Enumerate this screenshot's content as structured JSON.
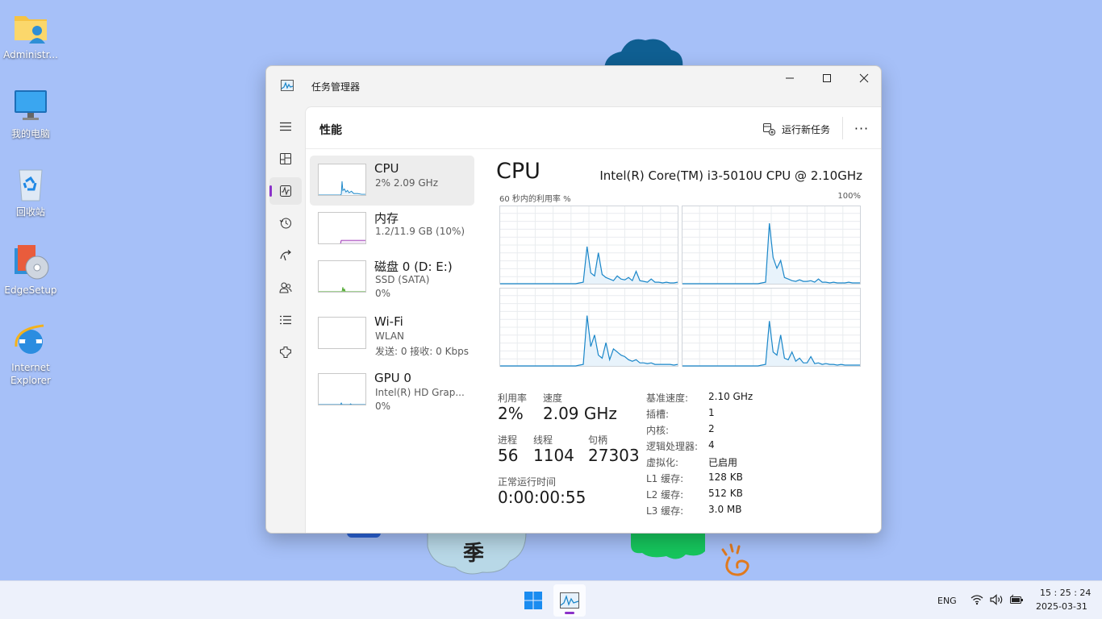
{
  "colors": {
    "accent": "#8b32c9",
    "cpu_line": "#1b87c9",
    "mem_line": "#9b30b4",
    "disk_line": "#4ea72e",
    "desktop": "#a6c0f8"
  },
  "desktop": {
    "icons": [
      {
        "label": "Administr...",
        "icon": "user-folder-icon"
      },
      {
        "label": "我的电脑",
        "icon": "monitor-icon"
      },
      {
        "label": "回收站",
        "icon": "recycle-bin-icon"
      },
      {
        "label": "EdgeSetup",
        "icon": "installer-icon"
      },
      {
        "label": "Internet\nExplorer",
        "icon": "internet-explorer-icon"
      }
    ],
    "wallpaper_glyph": "季"
  },
  "window": {
    "title": "任务管理器",
    "controls": [
      "minimize-icon",
      "maximize-icon",
      "close-icon"
    ],
    "nav": [
      "menu-icon",
      "processes-icon",
      "performance-icon",
      "app-history-icon",
      "startup-apps-icon",
      "users-icon",
      "details-icon",
      "services-icon",
      "settings-icon"
    ],
    "page_title": "性能",
    "run_new_task": "运行新任务",
    "more": "···"
  },
  "devices": [
    {
      "name": "CPU",
      "line1": "2% 2.09 GHz",
      "line2": ""
    },
    {
      "name": "内存",
      "line1": "1.2/11.9 GB (10%)",
      "line2": ""
    },
    {
      "name": "磁盘 0 (D: E:)",
      "line1": "SSD (SATA)",
      "line2": "0%"
    },
    {
      "name": "Wi-Fi",
      "line1": "WLAN",
      "line2": "发送: 0 接收: 0 Kbps"
    },
    {
      "name": "GPU 0",
      "line1": "Intel(R) HD Grap...",
      "line2": "0%"
    }
  ],
  "cpu": {
    "heading": "CPU",
    "model": "Intel(R) Core(TM) i3-5010U CPU @ 2.10GHz",
    "graph_label": "60 秒内的利用率 %",
    "graph_max": "100%",
    "stats": {
      "util_label": "利用率",
      "util": "2%",
      "speed_label": "速度",
      "speed": "2.09 GHz",
      "proc_label": "进程",
      "proc": "56",
      "threads_label": "线程",
      "threads": "1104",
      "handles_label": "句柄",
      "handles": "27303",
      "uptime_label": "正常运行时间",
      "uptime": "0:00:00:55"
    },
    "info": [
      {
        "label": "基准速度:",
        "value": "2.10 GHz"
      },
      {
        "label": "插槽:",
        "value": "1"
      },
      {
        "label": "内核:",
        "value": "2"
      },
      {
        "label": "逻辑处理器:",
        "value": "4"
      },
      {
        "label": "虚拟化:",
        "value": "已启用"
      },
      {
        "label": "L1 缓存:",
        "value": "128 KB"
      },
      {
        "label": "L2 缓存:",
        "value": "512 KB"
      },
      {
        "label": "L3 缓存:",
        "value": "3.0 MB"
      }
    ],
    "core_usage_pct": [
      [
        0,
        0,
        0,
        0,
        0,
        0,
        0,
        0,
        0,
        0,
        0,
        0,
        0,
        0,
        0,
        0,
        0,
        0,
        0,
        0,
        0,
        1,
        2,
        48,
        14,
        10,
        40,
        12,
        8,
        6,
        4,
        10,
        6,
        5,
        8,
        4,
        16,
        4,
        3,
        2,
        6,
        2,
        2,
        1,
        2,
        1,
        1,
        2
      ],
      [
        0,
        0,
        0,
        0,
        0,
        0,
        0,
        0,
        0,
        0,
        0,
        0,
        0,
        0,
        0,
        0,
        0,
        0,
        0,
        0,
        0,
        1,
        2,
        78,
        34,
        20,
        30,
        8,
        6,
        4,
        3,
        5,
        3,
        3,
        4,
        2,
        6,
        2,
        2,
        1,
        2,
        1,
        1,
        1,
        2,
        1,
        1,
        1
      ],
      [
        0,
        0,
        0,
        0,
        0,
        0,
        0,
        0,
        0,
        0,
        0,
        0,
        0,
        0,
        0,
        0,
        0,
        0,
        0,
        0,
        0,
        1,
        2,
        65,
        25,
        40,
        14,
        10,
        30,
        8,
        22,
        18,
        14,
        12,
        8,
        6,
        8,
        4,
        4,
        3,
        4,
        2,
        2,
        2,
        2,
        2,
        1,
        2
      ],
      [
        0,
        0,
        0,
        0,
        0,
        0,
        0,
        0,
        0,
        0,
        0,
        0,
        0,
        0,
        0,
        0,
        0,
        0,
        0,
        0,
        0,
        1,
        2,
        58,
        18,
        14,
        40,
        10,
        8,
        18,
        6,
        10,
        4,
        4,
        12,
        3,
        4,
        2,
        3,
        2,
        2,
        1,
        2,
        1,
        1,
        1,
        1,
        1
      ]
    ]
  },
  "taskbar": {
    "start": "windows-logo-icon",
    "app": "task-manager-icon",
    "lang": "ENG",
    "time": "15 : 25 : 24",
    "date": "2025-03-31"
  }
}
